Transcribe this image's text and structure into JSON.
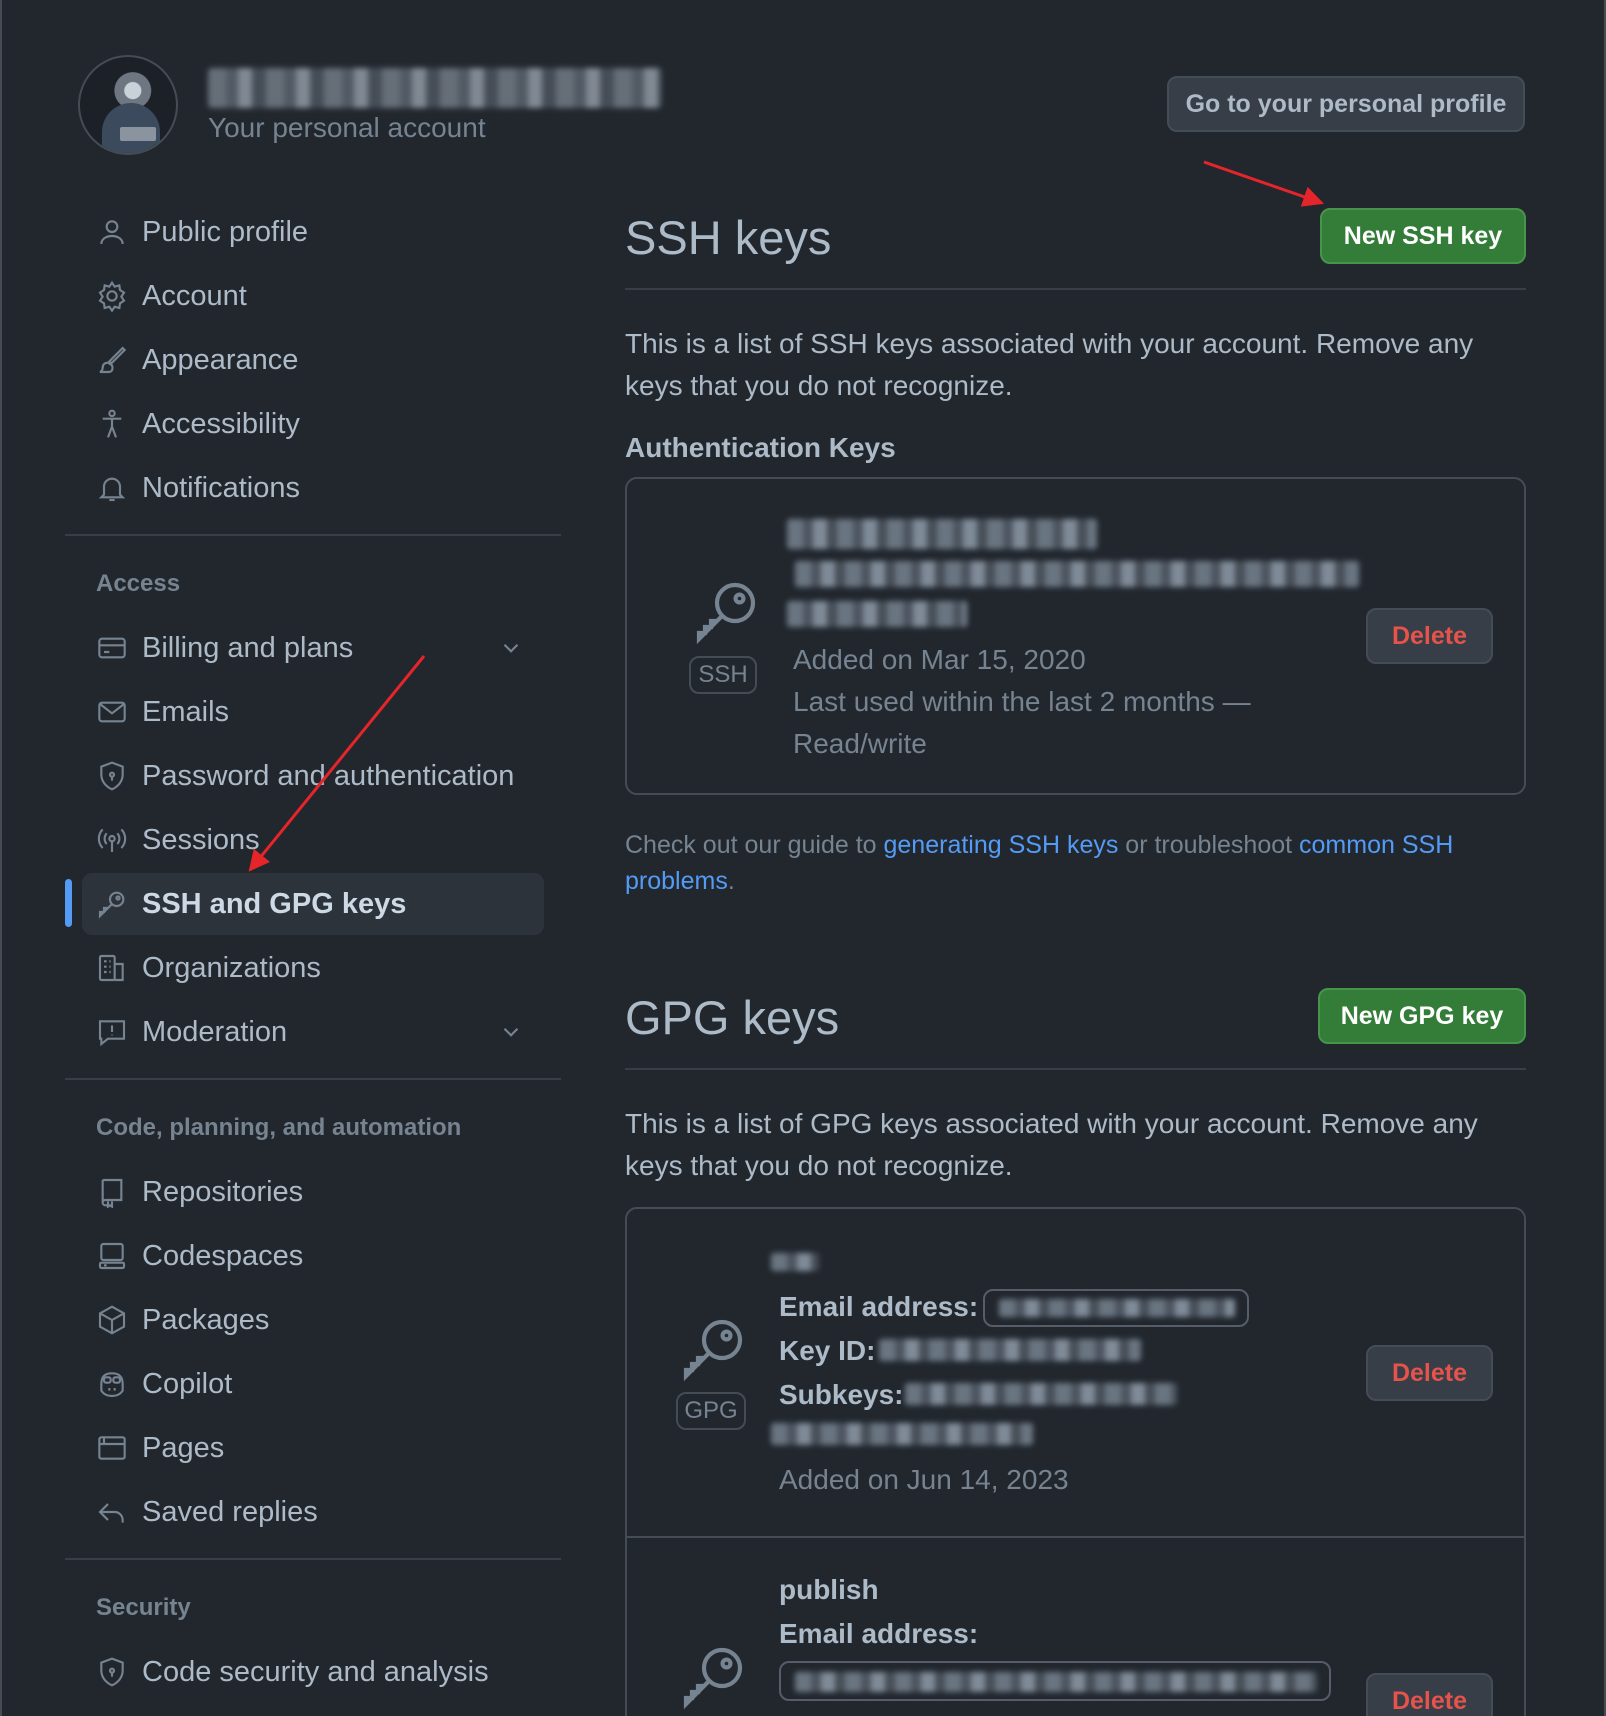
{
  "header": {
    "subtitle": "Your personal account",
    "profile_button": "Go to your personal profile"
  },
  "sidebar": {
    "top_items": [
      {
        "label": "Public profile",
        "icon": "person-icon"
      },
      {
        "label": "Account",
        "icon": "gear-icon"
      },
      {
        "label": "Appearance",
        "icon": "paintbrush-icon"
      },
      {
        "label": "Accessibility",
        "icon": "accessibility-icon"
      },
      {
        "label": "Notifications",
        "icon": "bell-icon"
      }
    ],
    "access_label": "Access",
    "access_items": [
      {
        "label": "Billing and plans",
        "icon": "credit-card-icon"
      },
      {
        "label": "Emails",
        "icon": "mail-icon"
      },
      {
        "label": "Password and authentication",
        "icon": "shield-icon"
      },
      {
        "label": "Sessions",
        "icon": "broadcast-icon"
      },
      {
        "label": "SSH and GPG keys",
        "icon": "key-icon"
      },
      {
        "label": "Organizations",
        "icon": "organization-icon"
      },
      {
        "label": "Moderation",
        "icon": "report-icon"
      }
    ],
    "code_label": "Code, planning, and automation",
    "code_items": [
      {
        "label": "Repositories",
        "icon": "repo-icon"
      },
      {
        "label": "Codespaces",
        "icon": "codespaces-icon"
      },
      {
        "label": "Packages",
        "icon": "package-icon"
      },
      {
        "label": "Copilot",
        "icon": "copilot-icon"
      },
      {
        "label": "Pages",
        "icon": "browser-icon"
      },
      {
        "label": "Saved replies",
        "icon": "reply-icon"
      }
    ],
    "security_label": "Security",
    "security_items": [
      {
        "label": "Code security and analysis",
        "icon": "shield-icon"
      }
    ]
  },
  "ssh": {
    "title": "SSH keys",
    "new_button": "New SSH key",
    "description": "This is a list of SSH keys associated with your account. Remove any keys that you do not recognize.",
    "auth_heading": "Authentication Keys",
    "key": {
      "tag": "SSH",
      "added": "Added on Mar 15, 2020",
      "last_used": "Last used within the last 2 months —",
      "access": "Read/write",
      "delete": "Delete"
    },
    "guide": {
      "prefix": "Check out our guide to ",
      "link1": "generating SSH keys",
      "middle": " or troubleshoot ",
      "link2": "common SSH problems",
      "suffix": "."
    }
  },
  "gpg": {
    "title": "GPG keys",
    "new_button": "New GPG key",
    "description": "This is a list of GPG keys associated with your account. Remove any keys that you do not recognize.",
    "key1": {
      "tag": "GPG",
      "email_label": "Email address:",
      "keyid_label": "Key ID:",
      "subkeys_label": "Subkeys:",
      "added": "Added on Jun 14, 2023",
      "delete": "Delete"
    },
    "key2": {
      "name": "publish",
      "email_label": "Email address:",
      "delete": "Delete"
    }
  },
  "colors": {
    "background": "#22272e",
    "accent_blue": "#539bf5",
    "green_button": "#347d39",
    "danger": "#e5534b",
    "annotation_arrow": "#e5252a"
  }
}
